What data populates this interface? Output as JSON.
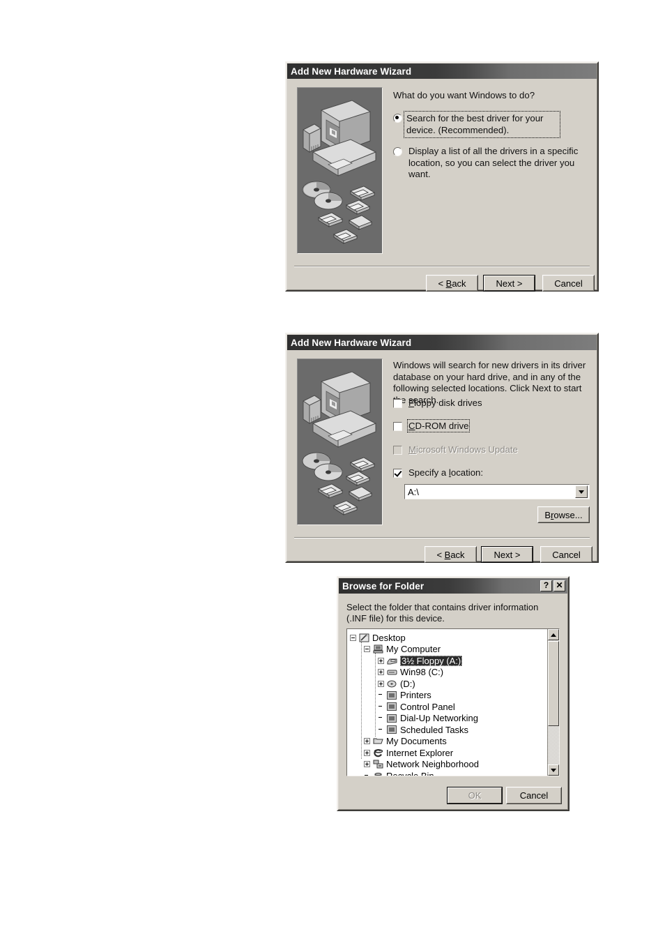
{
  "colors": {
    "dialog_face": "#d4d0c8",
    "titlebar_dark": "#2f2f2f",
    "titlebar_light": "#7d7d7d",
    "art_panel_bg": "#6b6b6b",
    "field_bg": "#ffffff",
    "disabled_text": "#8d8a85",
    "selection_bg": "#2b2b2b"
  },
  "dialog1": {
    "title": "Add New Hardware Wizard",
    "art_name": "computer-hardware-illustration",
    "prompt": "What do you want Windows to do?",
    "options": [
      {
        "label": "Search for the best driver for your device. (Recommended).",
        "selected": true,
        "focused": true
      },
      {
        "label": "Display a list of all the drivers in a specific location, so you can select the driver you want.",
        "selected": false,
        "focused": false
      }
    ],
    "buttons": {
      "back": "< Back",
      "back_pre": "< ",
      "back_accel": "B",
      "back_post": "ack",
      "next": "Next >",
      "cancel": "Cancel"
    }
  },
  "dialog2": {
    "title": "Add New Hardware Wizard",
    "art_name": "computer-hardware-illustration",
    "prompt": "Windows will search for new drivers in its driver database on your hard drive, and in any of the following selected locations. Click Next to start the search.",
    "checkboxes": [
      {
        "accel": "F",
        "rest": "loppy disk drives",
        "checked": false,
        "disabled": false,
        "focused": false
      },
      {
        "accel": "C",
        "rest": "D-ROM drive",
        "checked": false,
        "disabled": false,
        "focused": true
      },
      {
        "accel": "M",
        "rest": "icrosoft Windows Update",
        "checked": false,
        "disabled": true,
        "focused": false
      },
      {
        "accel": "",
        "rest": "Specify a location:",
        "checked": true,
        "disabled": false,
        "focused": false
      }
    ],
    "specify_label_pre": "Specify a ",
    "specify_label_accel": "l",
    "specify_label_post": "ocation:",
    "location_value": "A:\\",
    "browse": {
      "pre": "B",
      "accel": "r",
      "post": "owse..."
    },
    "browse_label": "Browse...",
    "buttons": {
      "back": "< Back",
      "next": "Next >",
      "cancel": "Cancel"
    }
  },
  "dialog3": {
    "title": "Browse for Folder",
    "help_button": "?",
    "close_button": "✕",
    "prompt": "Select the folder that contains driver information (.INF file) for this device.",
    "tree": [
      {
        "label": "Desktop",
        "depth": 0,
        "expander": "minus",
        "icon": "desktop-icon",
        "selected": false
      },
      {
        "label": "My Computer",
        "depth": 1,
        "expander": "minus",
        "icon": "computer-icon",
        "selected": false
      },
      {
        "label": "3½ Floppy (A:)",
        "depth": 2,
        "expander": "plus",
        "icon": "floppy-icon",
        "selected": true
      },
      {
        "label": "Win98 (C:)",
        "depth": 2,
        "expander": "plus",
        "icon": "harddisk-icon",
        "selected": false
      },
      {
        "label": "(D:)",
        "depth": 2,
        "expander": "plus",
        "icon": "cdrom-icon",
        "selected": false
      },
      {
        "label": "Printers",
        "depth": 2,
        "expander": "none",
        "icon": "printers-icon",
        "selected": false
      },
      {
        "label": "Control Panel",
        "depth": 2,
        "expander": "none",
        "icon": "control-panel-icon",
        "selected": false
      },
      {
        "label": "Dial-Up Networking",
        "depth": 2,
        "expander": "none",
        "icon": "dialup-icon",
        "selected": false
      },
      {
        "label": "Scheduled Tasks",
        "depth": 2,
        "expander": "none",
        "icon": "scheduled-tasks-icon",
        "selected": false
      },
      {
        "label": "My Documents",
        "depth": 1,
        "expander": "plus",
        "icon": "my-documents-icon",
        "selected": false
      },
      {
        "label": "Internet Explorer",
        "depth": 1,
        "expander": "plus",
        "icon": "internet-explorer-icon",
        "selected": false
      },
      {
        "label": "Network Neighborhood",
        "depth": 1,
        "expander": "plus",
        "icon": "network-icon",
        "selected": false
      },
      {
        "label": "Recycle Bin",
        "depth": 1,
        "expander": "none",
        "icon": "recycle-bin-icon",
        "selected": false
      }
    ],
    "scrollbar": {
      "up": "▲",
      "down": "▼",
      "thumb_top_pct": 0,
      "thumb_height_pct": 64
    },
    "buttons": {
      "ok": "OK",
      "ok_disabled": true,
      "cancel": "Cancel"
    }
  }
}
